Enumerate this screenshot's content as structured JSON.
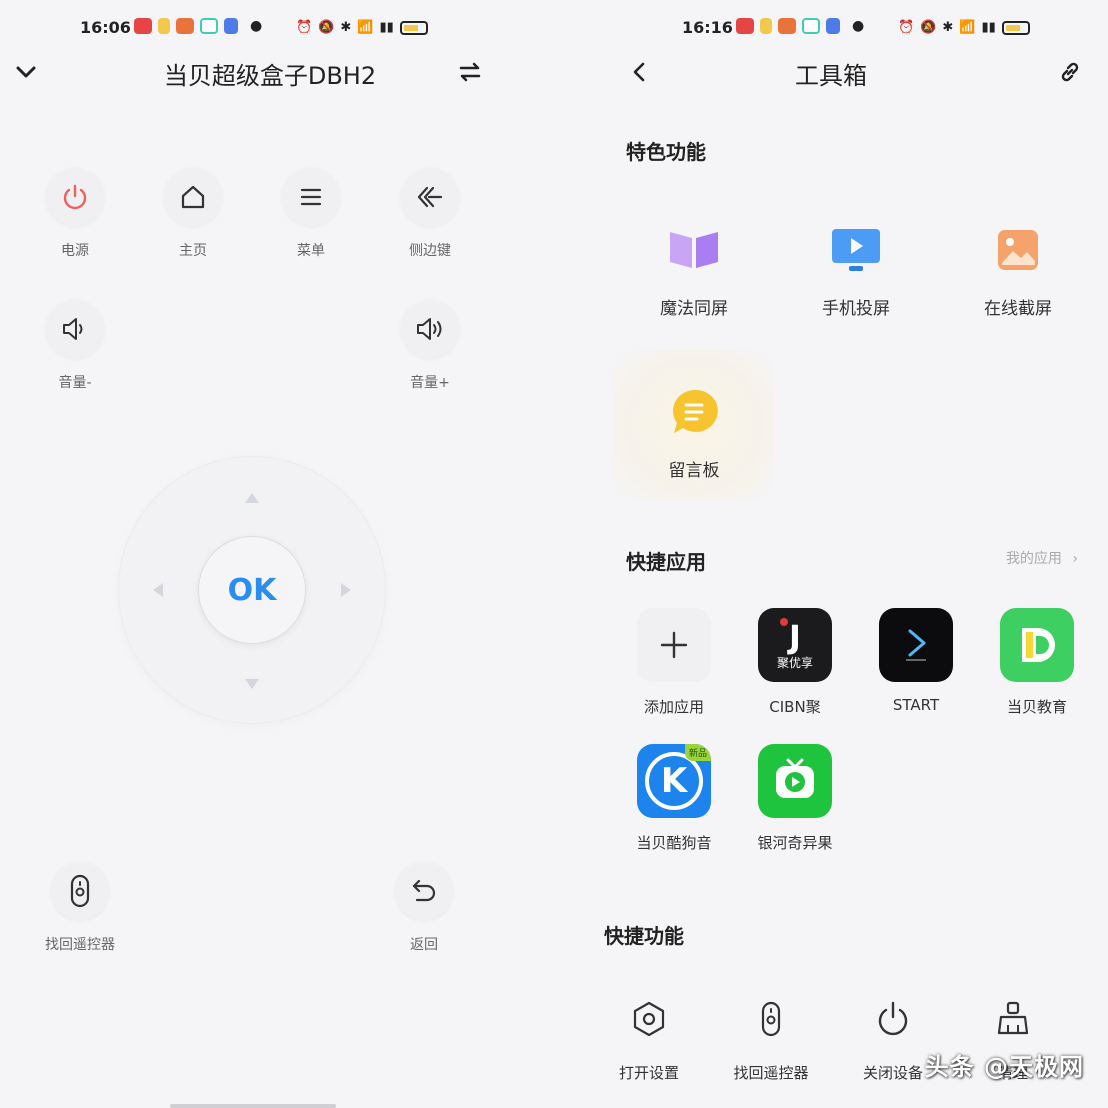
{
  "left": {
    "status": {
      "time": "16:06"
    },
    "header": {
      "title": "当贝超级盒子DBH2"
    },
    "buttons": {
      "power": "电源",
      "home": "主页",
      "menu": "菜单",
      "side": "侧边键",
      "vol_down": "音量-",
      "vol_up": "音量+",
      "ok": "OK",
      "find_remote": "找回遥控器",
      "back": "返回"
    }
  },
  "right": {
    "status": {
      "time": "16:16"
    },
    "header": {
      "title": "工具箱"
    },
    "featured": {
      "title": "特色功能",
      "items": [
        "魔法同屏",
        "手机投屏",
        "在线截屏",
        "留言板"
      ]
    },
    "quick_apps": {
      "title": "快捷应用",
      "my_apps": "我的应用",
      "items": [
        "添加应用",
        "CIBN聚",
        "START",
        "当贝教育",
        "当贝酷狗音",
        "银河奇异果"
      ],
      "icon_text": {
        "cibn_letter": "J",
        "cibn_sub": "聚优享",
        "koo_letter": "K",
        "koo_badge": "新品"
      }
    },
    "quick_functions": {
      "title": "快捷功能",
      "items": [
        "打开设置",
        "找回遥控器",
        "关闭设备",
        "清理"
      ]
    },
    "watermark": "头条 @天极网"
  },
  "colors": {
    "accent_blue": "#2a8ef0",
    "power_red": "#f0615e",
    "background": "#f5f5f7"
  },
  "icons": {
    "left_header": [
      "chevron-down-icon",
      "switch-icon"
    ],
    "right_header": [
      "back-icon",
      "link-icon"
    ]
  }
}
